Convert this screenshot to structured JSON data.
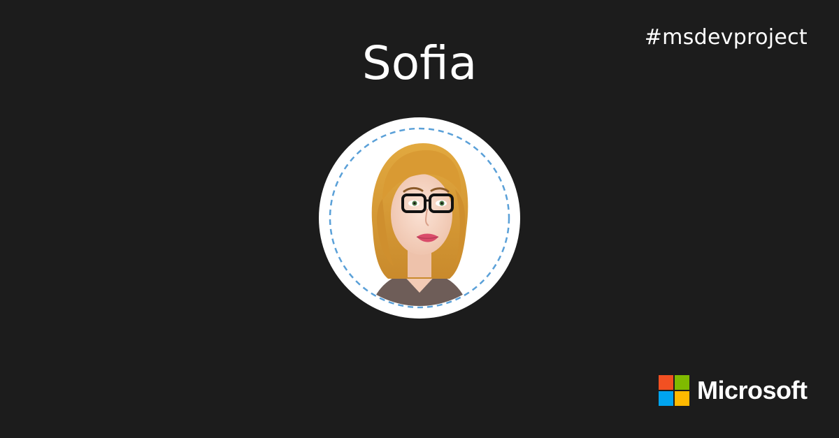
{
  "hashtag": "#msdevproject",
  "profile": {
    "name": "Sofia",
    "avatar_icon": "woman-avatar-icon"
  },
  "brand": {
    "wordmark": "Microsoft",
    "logo_colors": [
      "#f25022",
      "#7fba00",
      "#00a4ef",
      "#ffb900"
    ]
  },
  "colors": {
    "background": "#1c1c1c",
    "text": "#ffffff",
    "ring_dash": "#5aa0d8"
  }
}
